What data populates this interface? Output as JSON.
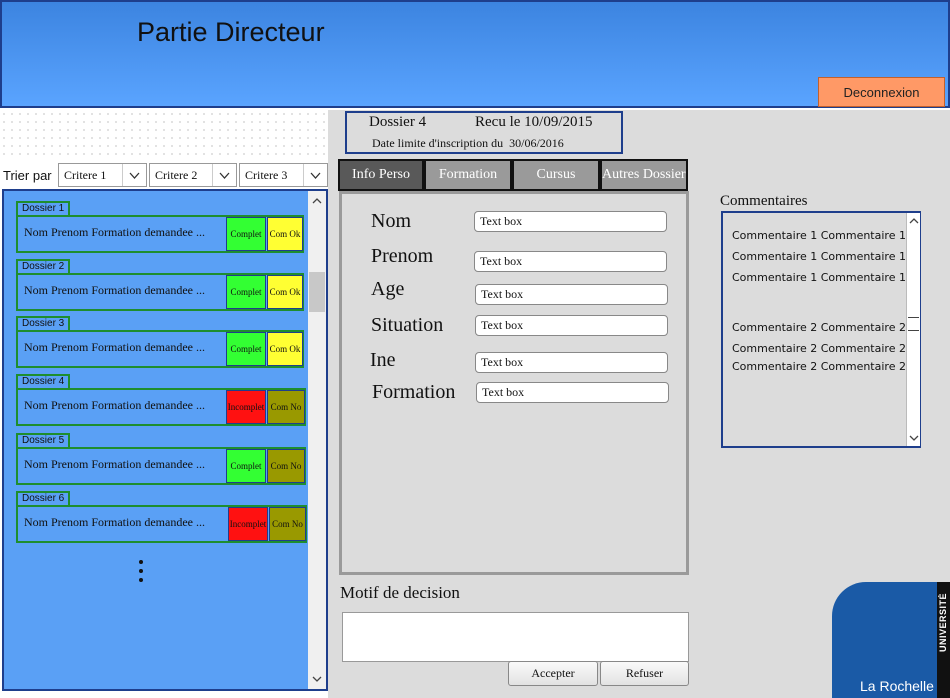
{
  "header": {
    "title": "Partie Directeur",
    "logout_label": "Deconnexion"
  },
  "sort": {
    "label": "Trier par",
    "criteria": [
      "Critere 1",
      "Critere 2",
      "Critere 3"
    ]
  },
  "dossiers": [
    {
      "label": "Dossier 1",
      "fields": "Nom   Prenom   Formation demandee  ...",
      "status": "Complet",
      "status_color": "#33ff33",
      "comment": "Com Ok",
      "comment_color": "#ffff33"
    },
    {
      "label": "Dossier 2",
      "fields": "Nom   Prenom   Formation demandee  ...",
      "status": "Complet",
      "status_color": "#33ff33",
      "comment": "Com Ok",
      "comment_color": "#ffff33"
    },
    {
      "label": "Dossier 3",
      "fields": "Nom   Prenom   Formation demandee  ...",
      "status": "Complet",
      "status_color": "#33ff33",
      "comment": "Com Ok",
      "comment_color": "#ffff33"
    },
    {
      "label": "Dossier 4",
      "fields": "Nom   Prenom   Formation demandee  ...",
      "status": "Incomplet",
      "status_color": "#ff1111",
      "comment": "Com No",
      "comment_color": "#999900"
    },
    {
      "label": "Dossier 5",
      "fields": "Nom   Prenom   Formation demandee  ...",
      "status": "Complet",
      "status_color": "#33ff33",
      "comment": "Com No",
      "comment_color": "#999900"
    },
    {
      "label": "Dossier 6",
      "fields": "Nom   Prenom   Formation demandee  ...",
      "status": "Incomplet",
      "status_color": "#ff1111",
      "comment": "Com No",
      "comment_color": "#999900"
    }
  ],
  "dossier_header": {
    "name": "Dossier 4",
    "received": "Recu le 10/09/2015",
    "deadline": "Date limite d'inscription du  30/06/2016"
  },
  "tabs": [
    "Info Perso",
    "Formation",
    "Cursus",
    "Autres Dossiers"
  ],
  "form": [
    {
      "label": "Nom",
      "value": "Text box"
    },
    {
      "label": "Prenom",
      "value": "Text box"
    },
    {
      "label": "Age",
      "value": "Text box"
    },
    {
      "label": "Situation",
      "value": "Text box"
    },
    {
      "label": "Ine",
      "value": "Text box"
    },
    {
      "label": "Formation",
      "value": "Text box"
    }
  ],
  "decision": {
    "label": "Motif de decision",
    "accept_label": "Accepter",
    "refuse_label": "Refuser"
  },
  "comments": {
    "label": "Commentaires",
    "lines": [
      "Commentaire 1 Commentaire 1",
      "Commentaire 1 Commentaire 1",
      "Commentaire 1 Commentaire 1",
      "Commentaire 2 Commentaire 2",
      "Commentaire 2 Commentaire 2",
      "Commentaire 2 Commentaire 2"
    ]
  },
  "logo": {
    "vertical_text": "UNIVERSITÉ",
    "text": "La Rochelle"
  },
  "colors": {
    "header": "#4a94f0",
    "panel": "#5aa0f5",
    "accent_border": "#1e3e8c",
    "logout": "#ff9966",
    "active_tab": "#595959",
    "inactive_tab": "#9a9a9a"
  }
}
